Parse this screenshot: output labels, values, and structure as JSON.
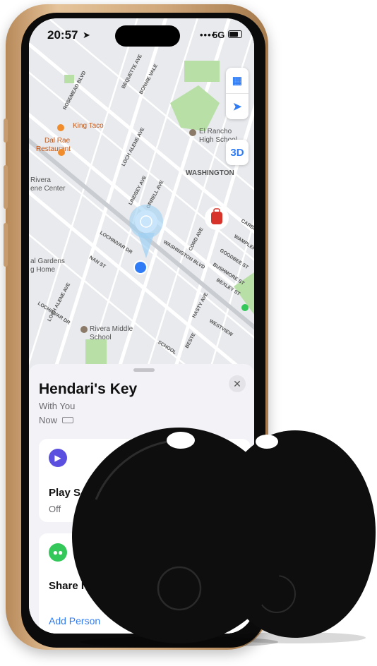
{
  "status_bar": {
    "time": "20:57",
    "signal": "••••",
    "network": "5G"
  },
  "map": {
    "labels": {
      "rosemead": "ROSEMEAD BLVD",
      "bequette": "BEQUETTE AVE",
      "bonnie_vale": "BONNIE VALE",
      "king_taco": "King Taco",
      "dal_rae": "Dal Rae",
      "restaurant": "Restaurant",
      "loch_alene": "LOCH ALENE AVE",
      "el_rancho": "El Rancho",
      "high_school": "High School",
      "washington": "WASHINGTON",
      "rivera": "Rivera",
      "ene_center": "ene Center",
      "lindsey": "LINDSEY AVE",
      "orrell": "ORRELL AVE",
      "lochinvar_dr": "LOCHINVAR DR",
      "gardens": "al Gardens",
      "g_home": "g Home",
      "nan_st": "NAN ST",
      "washington_blvd": "WASHINGTON BLVD",
      "cord": "CORD AVE",
      "carbo": "CARBO",
      "wampler": "WAMPLER",
      "goodbee": "GOODBEE ST",
      "bushmore": "BUSHMORE ST",
      "bexley": "BEXLEY ST",
      "loch_alene_2": "LOCH ALENE AVE",
      "lochinvar_2": "LOCHINVAR DR",
      "rivera_middle": "Rivera Middle",
      "school": "School",
      "hasty": "HASTY AVE",
      "westview": "WESTVIEW",
      "school_st": "SCHOOL",
      "beste": "BESTE"
    },
    "controls": {
      "map_icon": "map-icon",
      "locate_icon": "location-arrow-icon",
      "three_d": "3D"
    }
  },
  "sheet": {
    "title": "Hendari's Key",
    "subtitle": "With You",
    "updated": "Now",
    "play_sound": {
      "label": "Play S",
      "status": "Off"
    },
    "share": {
      "label": "Share I"
    },
    "add_person": "Add Person"
  },
  "colors": {
    "accent": "#2f7cf6",
    "play": "#5b4fe0",
    "share": "#34c759",
    "tracker": "#0e0e0e"
  }
}
